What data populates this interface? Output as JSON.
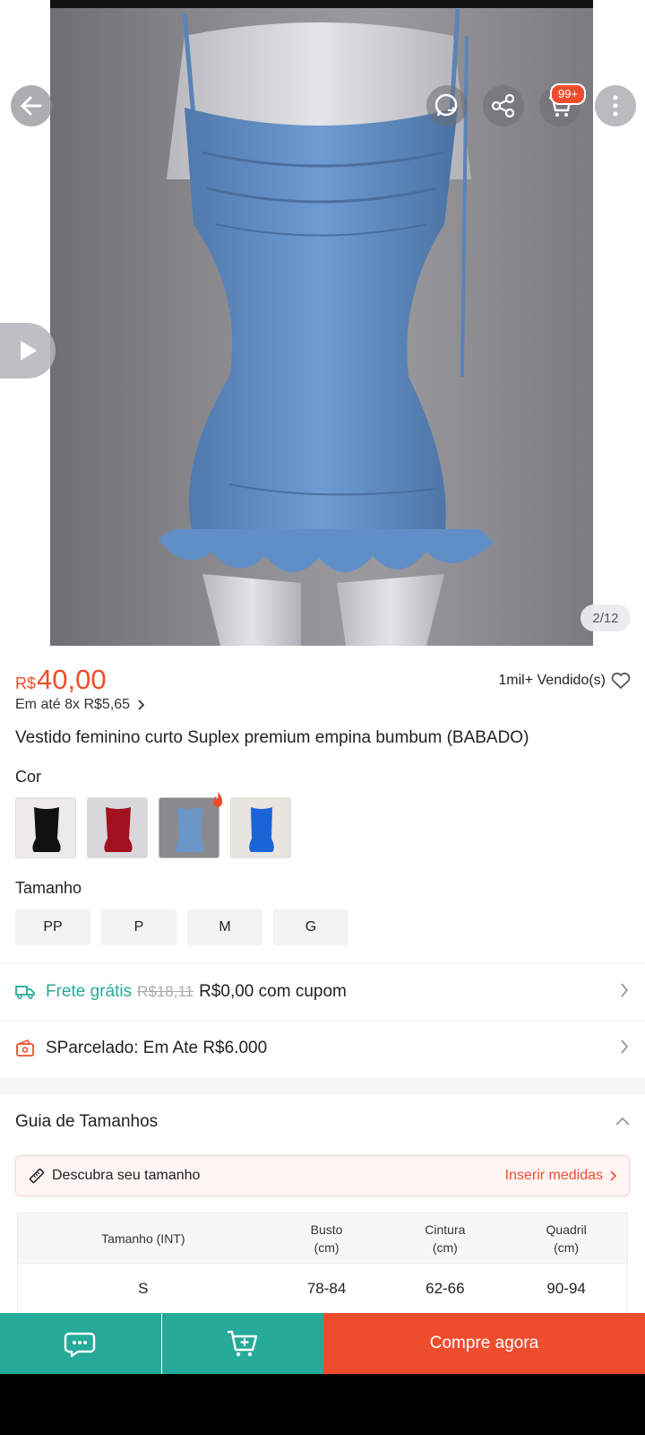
{
  "gallery": {
    "counter": "2/12"
  },
  "header": {
    "cart_badge": "99+"
  },
  "product": {
    "currency": "R$",
    "price": "40,00",
    "sold": "1mil+ Vendido(s)",
    "installments": "Em até 8x R$5,65",
    "title": "Vestido feminino curto Suplex premium empina bumbum (BABADO)"
  },
  "variants": {
    "color_label": "Cor",
    "colors": [
      "black",
      "red",
      "blue",
      "royal-blue"
    ],
    "size_label": "Tamanho",
    "sizes": [
      "PP",
      "P",
      "M",
      "G"
    ]
  },
  "shipping": {
    "label": "Frete grátis",
    "old_price": "R$18,11",
    "offer": "R$0,00 com cupom"
  },
  "financing": {
    "label": "SParcelado: Em Ate R$6.000"
  },
  "size_guide": {
    "title": "Guia de Tamanhos",
    "discover": "Descubra seu tamanho",
    "link": "Inserir medidas",
    "headers": [
      "Tamanho (INT)",
      "Busto",
      "(cm)",
      "Cintura",
      "(cm)",
      "Quadril",
      "(cm)"
    ],
    "rows": [
      [
        "S",
        "78-84",
        "62-66",
        "90-94"
      ]
    ]
  },
  "bottom_bar": {
    "buy_label": "Compre agora"
  },
  "colors": {
    "accent": "#ee4d2d",
    "green": "#26aa99"
  }
}
